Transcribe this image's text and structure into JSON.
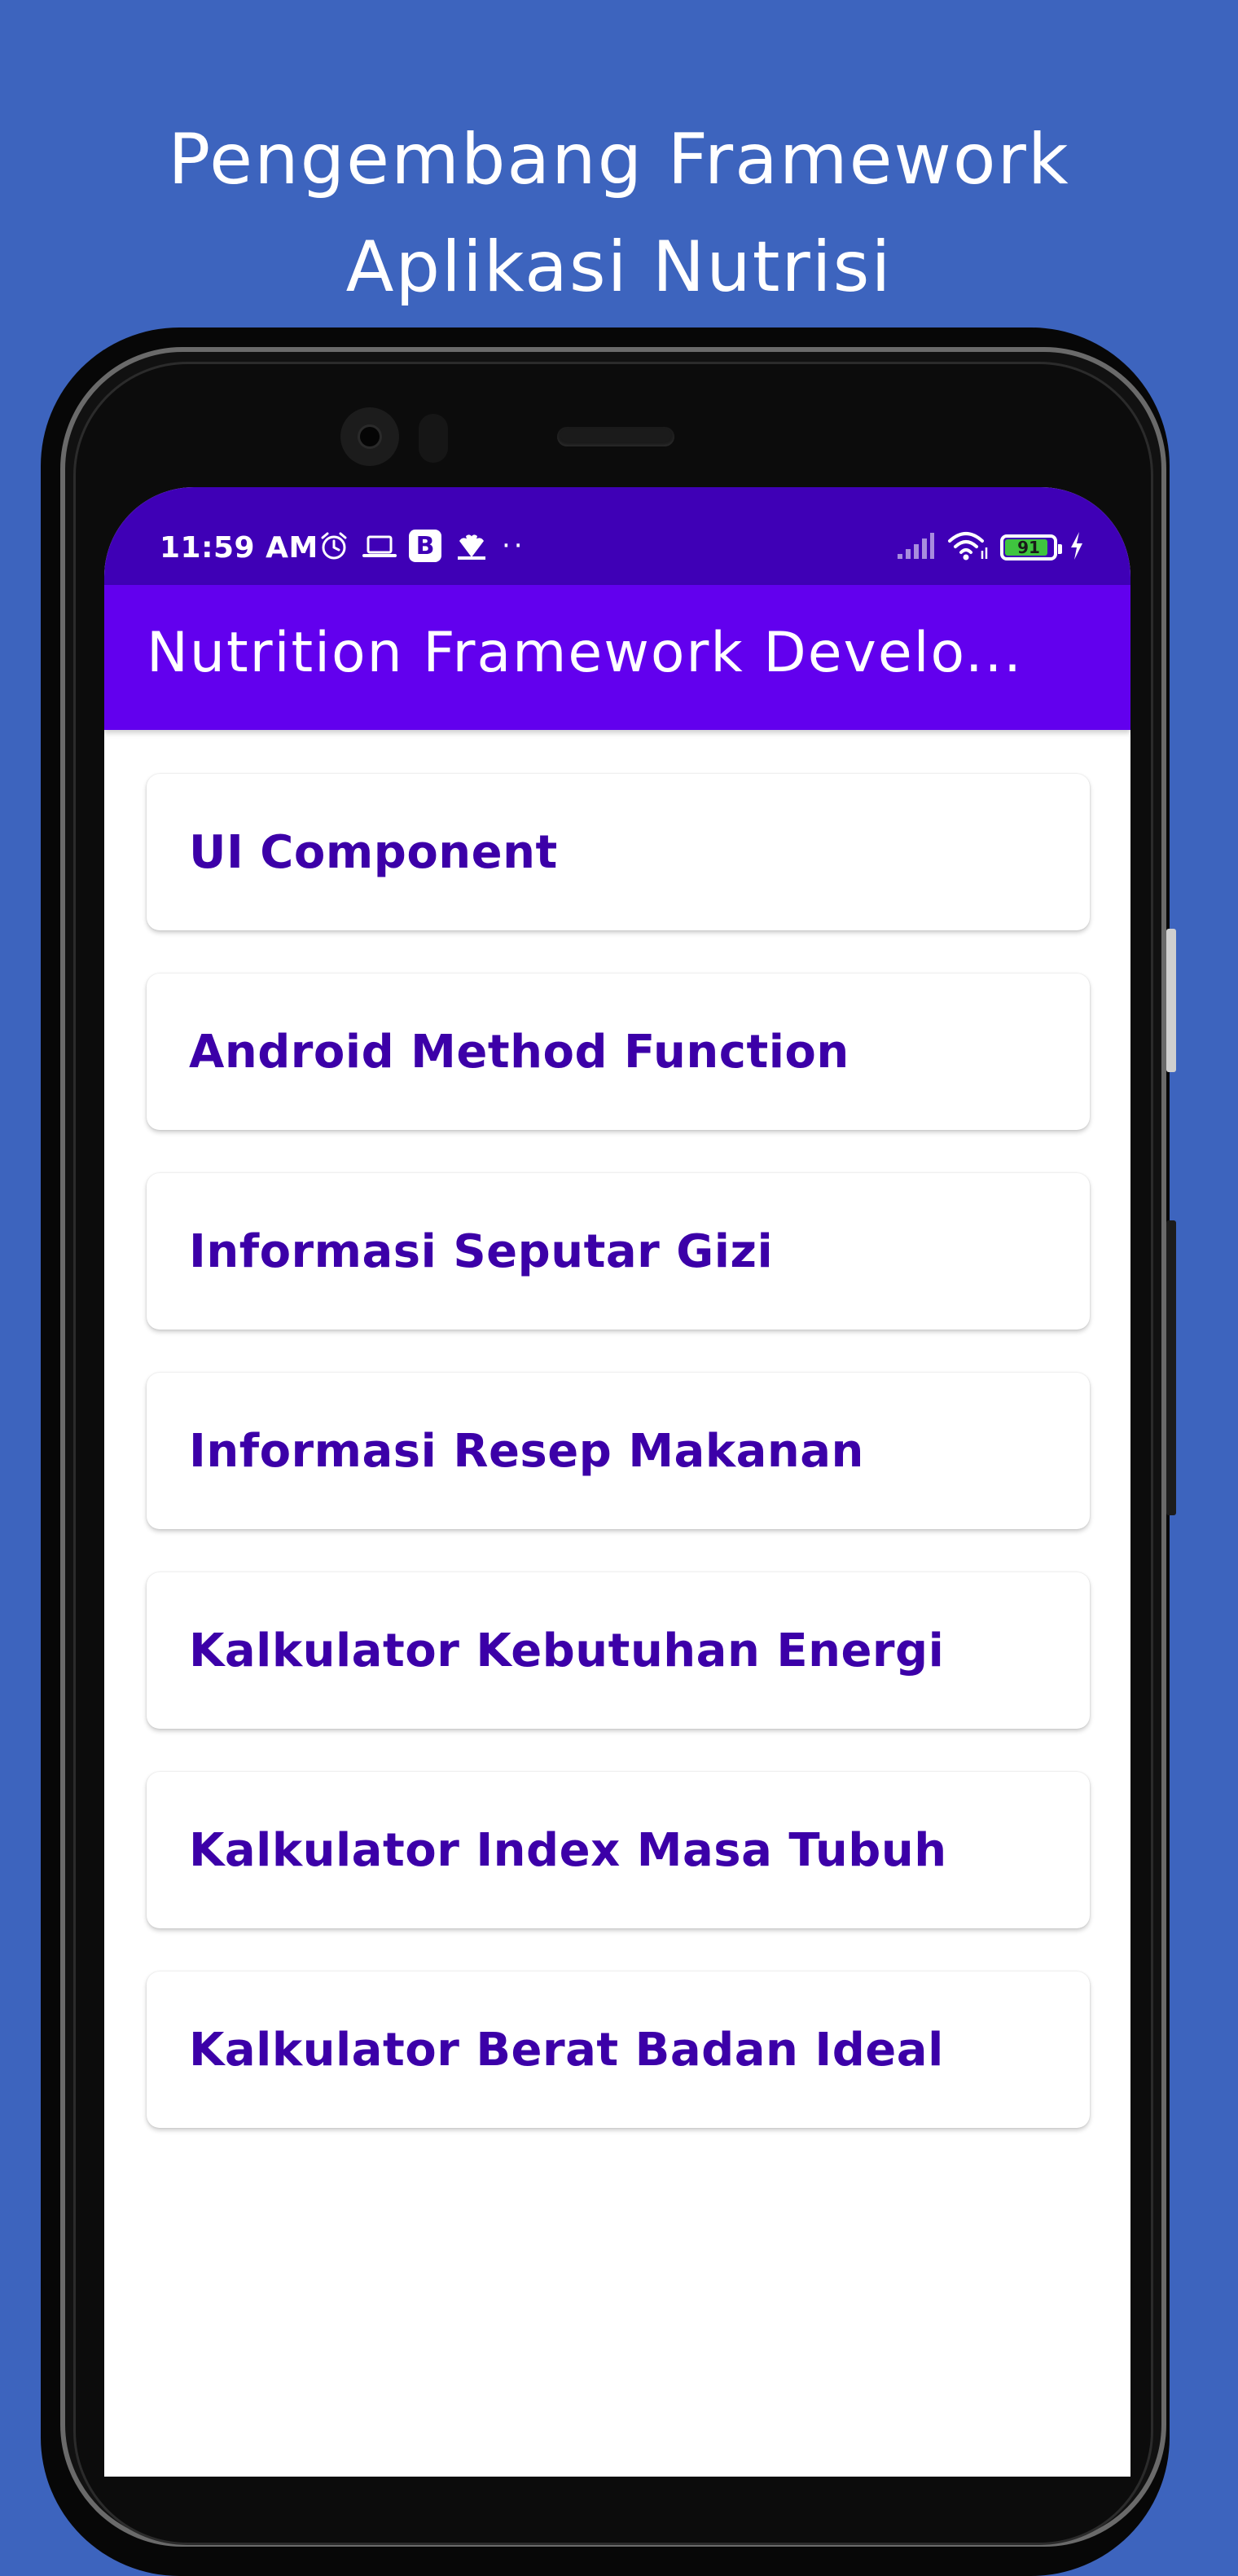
{
  "promo": {
    "line1": "Pengembang Framework",
    "line2": "Aplikasi Nutrisi"
  },
  "status_bar": {
    "time": "11:59 AM",
    "battery_level": 91,
    "battery_text": "91",
    "left_icons": [
      "alarm-icon",
      "laptop-icon",
      "b-app-icon",
      "peacock-icon",
      "more-dots-icon"
    ],
    "right_icons": [
      "signal-icon",
      "wifi-icon",
      "battery-icon",
      "charging-bolt-icon"
    ],
    "b_label": "B",
    "dots": "··"
  },
  "app_bar": {
    "title": "Nutrition Framework Develo..."
  },
  "menu": {
    "items": [
      {
        "label": "UI Component"
      },
      {
        "label": "Android Method Function"
      },
      {
        "label": "Informasi Seputar Gizi"
      },
      {
        "label": "Informasi Resep Makanan"
      },
      {
        "label": "Kalkulator Kebutuhan Energi"
      },
      {
        "label": "Kalkulator Index Masa Tubuh"
      },
      {
        "label": "Kalkulator Berat Badan Ideal"
      }
    ]
  },
  "colors": {
    "background": "#3D64BE",
    "status_bar": "#3F00B6",
    "app_bar": "#6200EE",
    "menu_text": "#3C00A8",
    "battery_fill": "#3FC43F"
  }
}
